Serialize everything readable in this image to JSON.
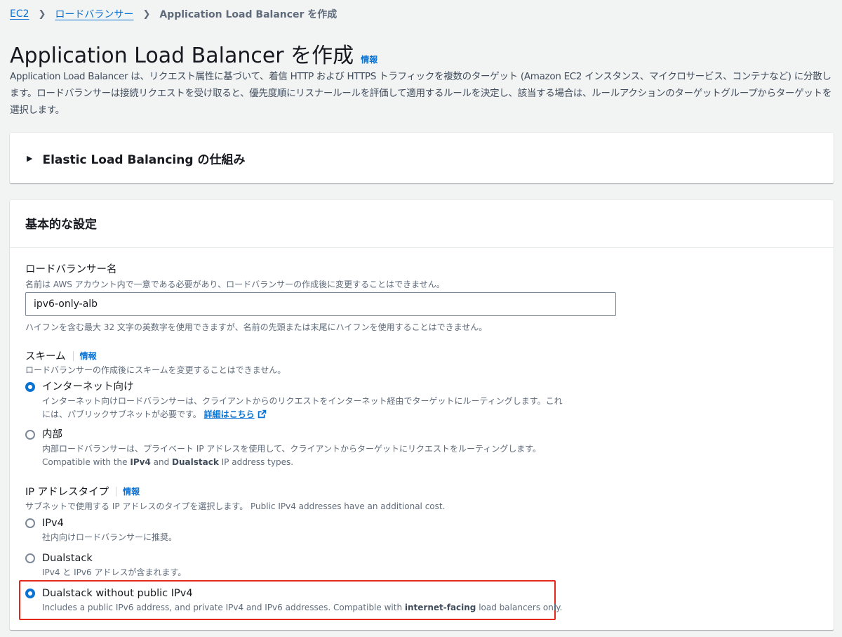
{
  "breadcrumb": {
    "items": [
      "EC2",
      "ロードバランサー"
    ],
    "current": "Application Load Balancer を作成"
  },
  "page": {
    "title": "Application Load Balancer を作成",
    "info": "情報",
    "description": "Application Load Balancer は、リクエスト属性に基づいて、着信 HTTP および HTTPS トラフィックを複数のターゲット (Amazon EC2 インスタンス、マイクロサービス、コンテナなど) に分散します。ロードバランサーは接続リクエストを受け取ると、優先度順にリスナールールを評価して適用するルールを決定し、該当する場合は、ルールアクションのターゲットグループからターゲットを選択します。"
  },
  "elb_section": {
    "title": "Elastic Load Balancing の仕組み"
  },
  "basic_config": {
    "title": "基本的な設定",
    "lb_name": {
      "label": "ロードバランサー名",
      "description": "名前は AWS アカウント内で一意である必要があり、ロードバランサーの作成後に変更することはできません。",
      "value": "ipv6-only-alb",
      "constraint": "ハイフンを含む最大 32 文字の英数字を使用できますが、名前の先頭または末尾にハイフンを使用することはできません。"
    },
    "scheme": {
      "label": "スキーム",
      "info": "情報",
      "description": "ロードバランサーの作成後にスキームを変更することはできません。",
      "options": [
        {
          "label": "インターネット向け",
          "desc_line1": "インターネット向けロードバランサーは、クライアントからのリクエストをインターネット経由でターゲットにルーティングします。これ",
          "desc_line2": "には、パブリックサブネットが必要です。",
          "link": "詳細はこちら",
          "checked": true
        },
        {
          "label": "内部",
          "desc_line1": "内部ロードバランサーは、プライベート IP アドレスを使用して、クライアントからターゲットにリクエストをルーティングします。",
          "desc_line2_parts": [
            "Compatible with the ",
            "IPv4",
            " and ",
            "Dualstack",
            " IP address types."
          ],
          "checked": false
        }
      ]
    },
    "ip_type": {
      "label": "IP アドレスタイプ",
      "info": "情報",
      "description": "サブネットで使用する IP アドレスのタイプを選択します。 Public IPv4 addresses have an additional cost.",
      "options": [
        {
          "label": "IPv4",
          "desc": "社内向けロードバランサーに推奨。",
          "checked": false
        },
        {
          "label": "Dualstack",
          "desc": "IPv4 と IPv6 アドレスが含まれます。",
          "checked": false
        },
        {
          "label": "Dualstack without public IPv4",
          "desc_parts": [
            "Includes a public IPv6 address, and private IPv4 and IPv6 addresses. Compatible with ",
            "internet-facing",
            " load balancers only."
          ],
          "checked": true
        }
      ]
    }
  },
  "colors": {
    "accent": "#0972d3",
    "highlight": "#e5281b",
    "background": "#f2f3f3"
  }
}
